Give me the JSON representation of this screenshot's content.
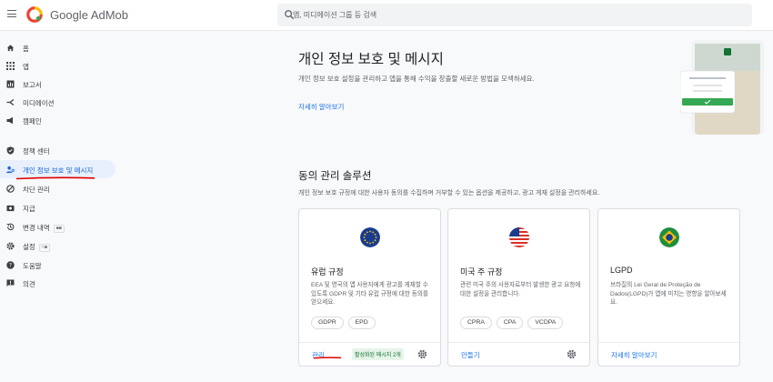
{
  "app": {
    "brand": "Google AdMob",
    "search_placeholder": "앱, 미디에이션 그룹 등 검색"
  },
  "sidebar": {
    "items": [
      {
        "label": "홈",
        "icon": "home-icon"
      },
      {
        "label": "앱",
        "icon": "apps-grid-icon"
      },
      {
        "label": "보고서",
        "icon": "report-icon"
      },
      {
        "label": "미디에이션",
        "icon": "mediation-icon"
      },
      {
        "label": "캠페인",
        "icon": "campaign-icon"
      },
      {
        "label": "정책 센터",
        "icon": "policy-shield-icon"
      },
      {
        "label": "개인 정보 보호 및 메시지",
        "icon": "privacy-user-icon",
        "active": true
      },
      {
        "label": "차단 관리",
        "icon": "block-icon"
      },
      {
        "label": "지급",
        "icon": "payments-icon"
      },
      {
        "label": "변경 내역",
        "icon": "history-icon",
        "badge": "■■"
      },
      {
        "label": "설정",
        "icon": "settings-icon",
        "badge": "□■"
      },
      {
        "label": "도움말",
        "icon": "help-icon"
      },
      {
        "label": "의견",
        "icon": "feedback-icon"
      }
    ]
  },
  "header": {
    "title": "개인 정보 보호 및 메시지",
    "description": "개인 정보 보호 설정을 관리하고 앱을 통해 수익을 창출할 새로운 방법을 모색하세요.",
    "learn_more": "자세히 알아보기"
  },
  "consent": {
    "title": "동의 관리 솔루션",
    "description": "개인 정보 보호 규정에 대한 사용자 동의를 수집하며 거부할 수 있는 옵션을 제공하고, 광고 게재 설정을 관리하세요."
  },
  "cards": [
    {
      "flag": "eu-flag-icon",
      "title": "유럽 규정",
      "description": "EEA 및 영국의 앱 사용자에게 광고를 게재할 수 있도록 GDPR 및 기타 유럽 규정에 대한 동의를 얻으세요.",
      "chips": [
        "GDPR",
        "EPD"
      ],
      "action": "관리",
      "status": "활성화된 메시지 2개"
    },
    {
      "flag": "us-flag-icon",
      "title": "미국 주 규정",
      "description": "관련 미국 주의 사용자로부터 발생한 광고 요청에 대한 설정을 관리합니다.",
      "chips": [
        "CPRA",
        "CPA",
        "VCDPA"
      ],
      "action": "만들기"
    },
    {
      "flag": "brazil-flag-icon",
      "title": "LGPD",
      "description": "브라질의 Lei Geral de Proteção de Dados(LGPD)가 앱에 미치는 영향을 알아보세요.",
      "chips": [],
      "action": "자세히 알아보기"
    }
  ],
  "colors": {
    "accent": "#1a73e8",
    "active_nav_bg": "#e8f0fe",
    "status_bg": "#e6f4ea",
    "status_text": "#137333",
    "annotation_red": "#e00000"
  }
}
